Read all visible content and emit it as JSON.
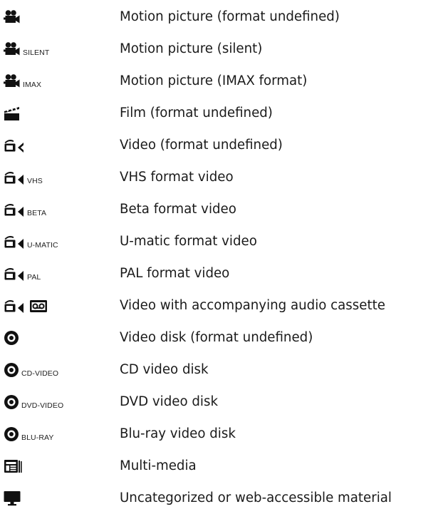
{
  "items": [
    {
      "icon": "motion-picture-icon",
      "tag": "",
      "label": "Motion picture (format undefined)"
    },
    {
      "icon": "motion-picture-icon",
      "tag": "SILENT",
      "label": "Motion picture (silent)"
    },
    {
      "icon": "motion-picture-icon",
      "tag": "IMAX",
      "label": "Motion picture (IMAX format)"
    },
    {
      "icon": "clapperboard-icon",
      "tag": "",
      "label": "Film (format undefined)"
    },
    {
      "icon": "video-camera-icon",
      "tag": "",
      "label": "Video (format undefined)"
    },
    {
      "icon": "video-camera-icon",
      "tag": "VHS",
      "label": "VHS format video"
    },
    {
      "icon": "video-camera-icon",
      "tag": "BETA",
      "label": "Beta format video"
    },
    {
      "icon": "video-camera-icon",
      "tag": "U-MATIC",
      "label": "U-matic format video"
    },
    {
      "icon": "video-camera-icon",
      "tag": "PAL",
      "label": "PAL format video"
    },
    {
      "icon": "video-camera-cassette-icon",
      "tag": "",
      "label": "Video with accompanying audio cassette"
    },
    {
      "icon": "disc-icon",
      "tag": "",
      "label": "Video disk (format undefined)"
    },
    {
      "icon": "disc-icon",
      "tag": "CD-VIDEO",
      "label": "CD video disk"
    },
    {
      "icon": "disc-icon",
      "tag": "DVD-VIDEO",
      "label": "DVD video disk"
    },
    {
      "icon": "disc-icon",
      "tag": "BLU-RAY",
      "label": "Blu-ray video disk"
    },
    {
      "icon": "multimedia-icon",
      "tag": "",
      "label": "Multi-media"
    },
    {
      "icon": "desktop-monitor-icon",
      "tag": "",
      "label": "Uncategorized or web-accessible material"
    }
  ]
}
